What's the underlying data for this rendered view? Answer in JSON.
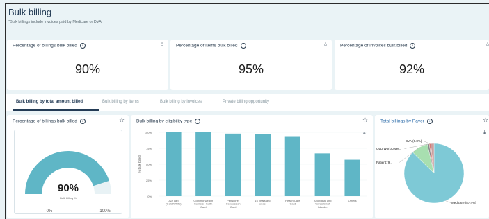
{
  "header": {
    "title": "Bulk billing",
    "subtitle": "*Bulk billings include invoices paid by Medicare or DVA"
  },
  "kpis": [
    {
      "label": "Percentage of billings bulk billed",
      "value": "90%"
    },
    {
      "label": "Percentage of items bulk billed",
      "value": "95%"
    },
    {
      "label": "Percentage of invoices bulk billed",
      "value": "92%"
    }
  ],
  "tabs": [
    {
      "label": "Bulk billing by total amount billed",
      "active": true
    },
    {
      "label": "Bulk billing by items",
      "active": false
    },
    {
      "label": "Bulk billing by invoices",
      "active": false
    },
    {
      "label": "Private billing opportunity",
      "active": false
    }
  ],
  "gauge": {
    "title": "Percentage of billings bulk billed",
    "value_text": "90%",
    "value": 90,
    "caption": "Bulk billing %",
    "min_label": "0%",
    "max_label": "100%"
  },
  "bar_title": "Bulk billing by eligibility type",
  "pie_title": "Total billings by Payer",
  "icons": {
    "info": "i",
    "star": "☆",
    "download": "⤓"
  },
  "colors": {
    "bar": "#5fb6c6",
    "pie_main": "#7ec9d6",
    "pie_green": "#a8dfb0",
    "pie_red": "#d77b76",
    "pie_gray": "#8a8a8a"
  },
  "chart_data": [
    {
      "type": "bar",
      "title": "Bulk billing by eligibility type",
      "ylabel": "% bulk billed",
      "ylim": [
        0,
        100
      ],
      "yticks": [
        "0%",
        "25%",
        "50%",
        "75%",
        "100%"
      ],
      "categories": [
        "DVA card (Gold/White)",
        "Commonwealth Seniors Health Card",
        "Pensioner Concession Card",
        "16 years and under",
        "Health Care Card",
        "Aboriginal and Torres Strait Islander",
        "Others"
      ],
      "values": [
        100,
        100,
        98,
        97,
        94,
        67,
        57
      ]
    },
    {
      "type": "pie",
      "title": "Total billings by Payer",
      "slices": [
        {
          "label": "Medicare:(87.4%)",
          "value": 87.4
        },
        {
          "label": "Patient:(9...",
          "value": 9.0
        },
        {
          "label": "QLD WorkCover...",
          "value": 1.0
        },
        {
          "label": "DVA:(0.8%)",
          "value": 0.8
        },
        {
          "label": "",
          "value": 1.8
        }
      ]
    }
  ]
}
